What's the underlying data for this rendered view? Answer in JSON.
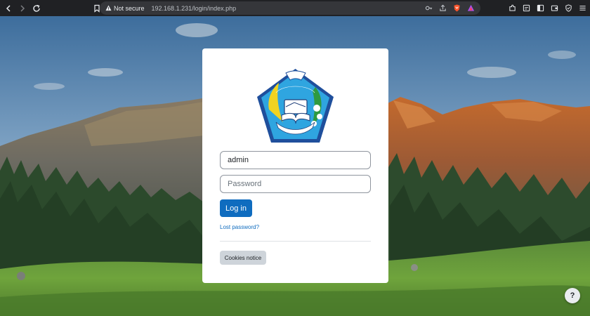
{
  "browser": {
    "security_label": "Not secure",
    "url": "192.168.1.231/login/index.php"
  },
  "login": {
    "username_value": "admin",
    "password_placeholder": "Password",
    "login_button": "Log in",
    "lost_password": "Lost password?",
    "cookies_button": "Cookies notice"
  },
  "logo": {
    "top_text": "WIDIA CITTA KRIYANTA",
    "bottom_text": "SMK NEGERI 1 PENGASIH"
  },
  "help": {
    "label": "?"
  },
  "colors": {
    "primary": "#0f6cbf",
    "secondary": "#ced4da",
    "chrome": "#202124"
  }
}
